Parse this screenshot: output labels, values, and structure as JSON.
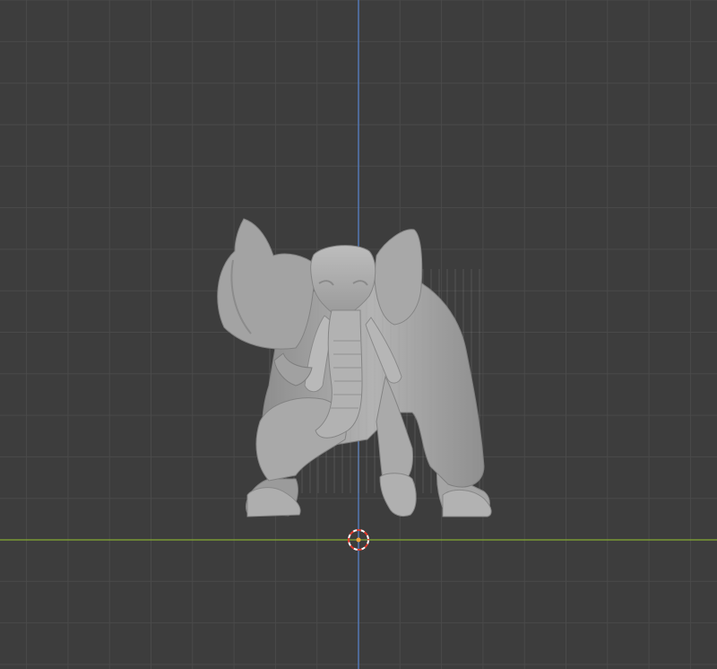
{
  "viewport": {
    "background": "#3d3d3d",
    "grid_color": "#4a4a4a",
    "x_axis_color": "#7a9a34",
    "z_axis_color": "#5478b3",
    "cursor_colors": [
      "#e23b2e",
      "#ffffff"
    ]
  },
  "scene": {
    "object": "elephant-sculpt-mesh",
    "mesh_color": "#a7a7a7",
    "cursor": "3d-cursor-icon"
  }
}
